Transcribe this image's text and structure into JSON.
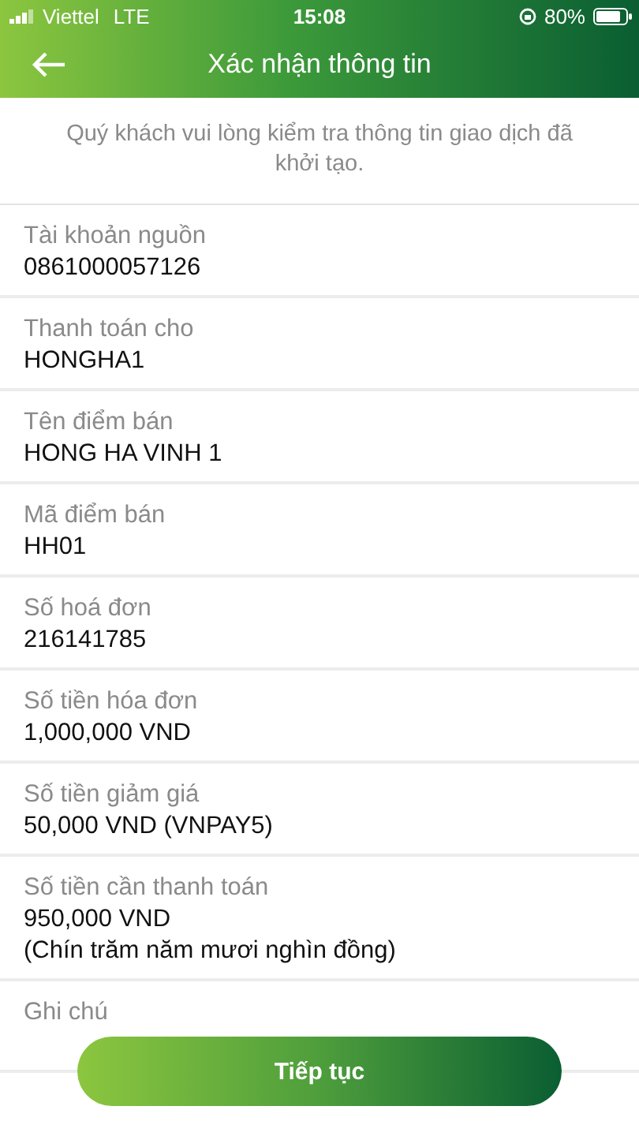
{
  "status_bar": {
    "carrier": "Viettel",
    "network": "LTE",
    "time": "15:08",
    "battery": "80%"
  },
  "header": {
    "title": "Xác nhận thông tin"
  },
  "intro": "Quý khách vui lòng kiểm tra thông tin giao dịch đã khởi tạo.",
  "fields": [
    {
      "label": "Tài khoản nguồn",
      "values": [
        "0861000057126"
      ]
    },
    {
      "label": "Thanh toán cho",
      "values": [
        "HONGHA1"
      ]
    },
    {
      "label": "Tên điểm bán",
      "values": [
        "HONG HA VINH 1"
      ]
    },
    {
      "label": "Mã điểm bán",
      "values": [
        "HH01"
      ]
    },
    {
      "label": "Số hoá đơn",
      "values": [
        "216141785"
      ]
    },
    {
      "label": "Số tiền hóa đơn",
      "values": [
        "1,000,000 VND"
      ]
    },
    {
      "label": "Số tiền giảm giá",
      "values": [
        "50,000 VND (VNPAY5)"
      ]
    },
    {
      "label": "Số tiền cần thanh toán",
      "values": [
        "950,000 VND",
        "(Chín trăm năm mươi nghìn đồng)"
      ]
    },
    {
      "label": "Ghi chú"
    }
  ],
  "continue_button": "Tiếp tục"
}
